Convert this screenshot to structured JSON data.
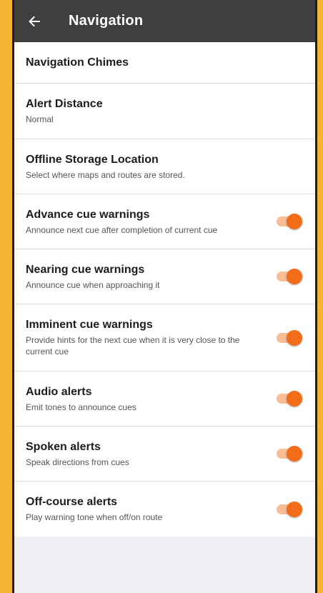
{
  "colors": {
    "frame": "#f5b335",
    "appbar": "#3f3f3f",
    "accent": "#f26c1a"
  },
  "appbar": {
    "title": "Navigation",
    "back_icon": "arrow-left-icon"
  },
  "settings": [
    {
      "title": "Navigation Chimes",
      "subtitle": null,
      "toggle": null
    },
    {
      "title": "Alert Distance",
      "subtitle": "Normal",
      "toggle": null
    },
    {
      "title": "Offline Storage Location",
      "subtitle": "Select where maps and routes are stored.",
      "toggle": null
    },
    {
      "title": "Advance cue warnings",
      "subtitle": "Announce next cue after completion of current cue",
      "toggle": true
    },
    {
      "title": "Nearing cue warnings",
      "subtitle": "Announce cue when approaching it",
      "toggle": true
    },
    {
      "title": "Imminent cue warnings",
      "subtitle": "Provide hints for the next cue when it is very close to the current cue",
      "toggle": true
    },
    {
      "title": "Audio alerts",
      "subtitle": "Emit tones to announce cues",
      "toggle": true
    },
    {
      "title": "Spoken alerts",
      "subtitle": "Speak directions from cues",
      "toggle": true
    },
    {
      "title": "Off-course alerts",
      "subtitle": "Play warning tone when off/on route",
      "toggle": true
    }
  ]
}
